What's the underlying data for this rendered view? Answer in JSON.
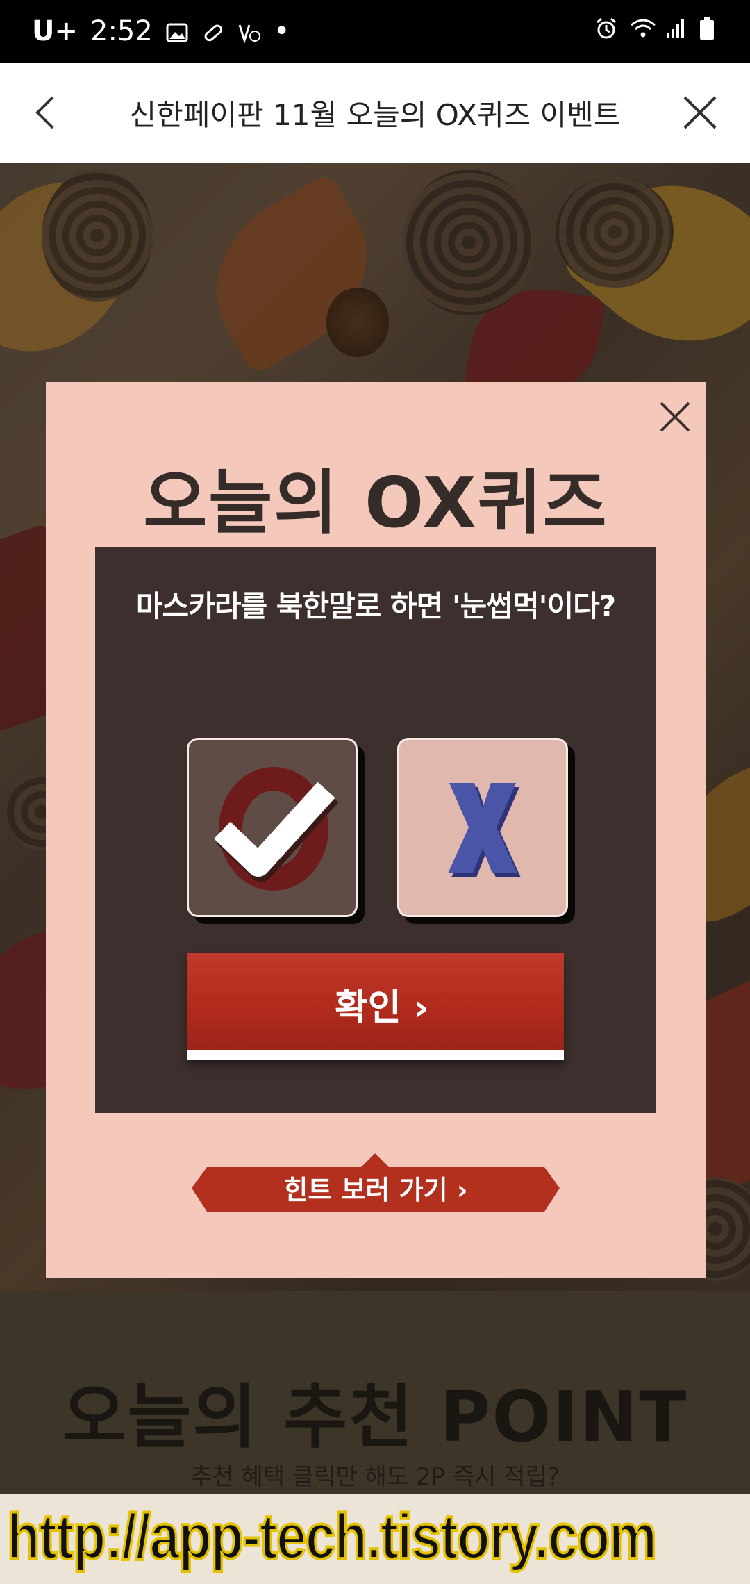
{
  "status_bar": {
    "carrier": "U+",
    "time": "2:52",
    "dot": "•"
  },
  "header": {
    "title": "신한페이판 11월 오늘의 OX퀴즈 이벤트"
  },
  "modal": {
    "title": "오늘의 OX퀴즈",
    "question": "마스카라를 북한말로 하면 '눈썹먹'이다?",
    "option_o": "O",
    "option_x": "X",
    "selected": "O",
    "confirm_label": "확인",
    "confirm_arrow": "›",
    "hint_label": "힌트 보러 가기",
    "hint_arrow": "›"
  },
  "recommend": {
    "title": "오늘의 추천 POINT",
    "subtitle": "추천 혜택 클릭만 해도 2P 즉시 적립?"
  },
  "watermark": {
    "text": "http://app-tech.tistory.com"
  },
  "colors": {
    "modal_bg": "#f4c9bc",
    "quiz_bg": "#3c2f2d",
    "accent_red": "#b02a1c",
    "x_blue": "#4a55a8"
  }
}
